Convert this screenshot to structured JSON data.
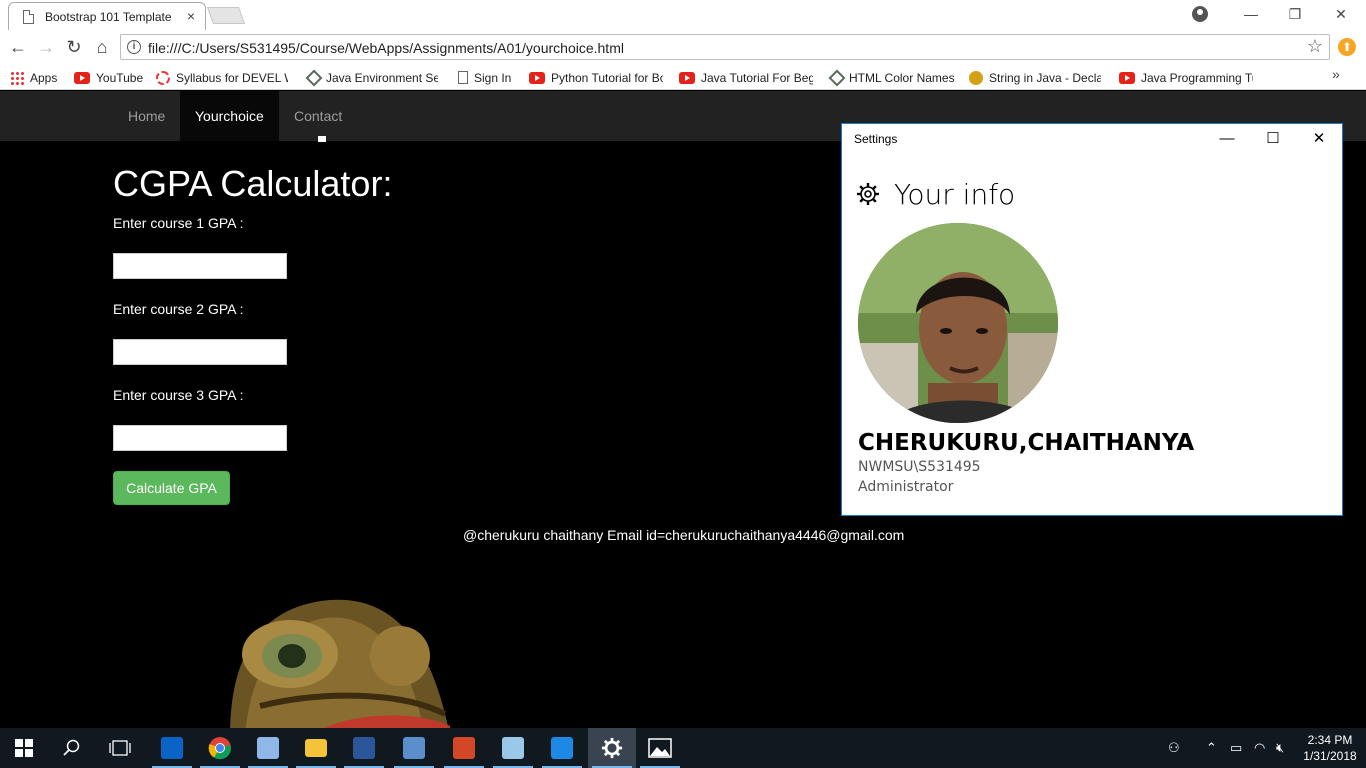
{
  "browser": {
    "tab_title": "Bootstrap 101 Template",
    "tab_close": "×",
    "window_controls": {
      "minimize": "—",
      "restore": "❐",
      "close": "✕"
    },
    "url": "file:///C:/Users/S531495/Course/WebApps/Assignments/A01/yourchoice.html",
    "back": "←",
    "forward": "→",
    "reload": "↻",
    "home": "⌂",
    "star": "☆",
    "bookmarks_more": "»",
    "bookmarks": [
      {
        "label": "Apps",
        "icon": "apps-grid-icon"
      },
      {
        "label": "YouTube",
        "icon": "youtube-icon"
      },
      {
        "label": "Syllabus for DEVEL W",
        "icon": "ring-icon"
      },
      {
        "label": "Java Environment Set",
        "icon": "diamond-icon"
      },
      {
        "label": "Sign In",
        "icon": "document-icon"
      },
      {
        "label": "Python Tutorial for Bo",
        "icon": "youtube-icon"
      },
      {
        "label": "Java Tutorial For Begi",
        "icon": "youtube-icon"
      },
      {
        "label": "HTML Color Names",
        "icon": "diamond-icon"
      },
      {
        "label": "String in Java - Declar",
        "icon": "java-icon"
      },
      {
        "label": "Java Programming Tu",
        "icon": "youtube-icon"
      }
    ]
  },
  "page": {
    "nav": [
      {
        "label": "Home",
        "active": false
      },
      {
        "label": "Yourchoice",
        "active": true
      },
      {
        "label": "Contact",
        "active": false
      }
    ],
    "title": "CGPA Calculator:",
    "fields": [
      {
        "label": "Enter course 1 GPA :",
        "value": ""
      },
      {
        "label": "Enter course 2 GPA :",
        "value": ""
      },
      {
        "label": "Enter course 3 GPA :",
        "value": ""
      }
    ],
    "button_label": "Calculate GPA",
    "footer": "@cherukuru chaithany Email id=cherukuruchaithanya4446@gmail.com"
  },
  "settings": {
    "window_title": "Settings",
    "controls": {
      "minimize": "—",
      "maximize": "☐",
      "close": "✕"
    },
    "heading": "Your info",
    "user_name": "CHERUKURU,CHAITHANYA",
    "account": "NWMSU\\S531495",
    "role": "Administrator"
  },
  "taskbar": {
    "time": "2:34 PM",
    "date": "1/31/2018"
  },
  "colors": {
    "navbar": "#222222",
    "button_green": "#5cb85c",
    "settings_border": "#1979ca",
    "taskbar": "#101820"
  }
}
